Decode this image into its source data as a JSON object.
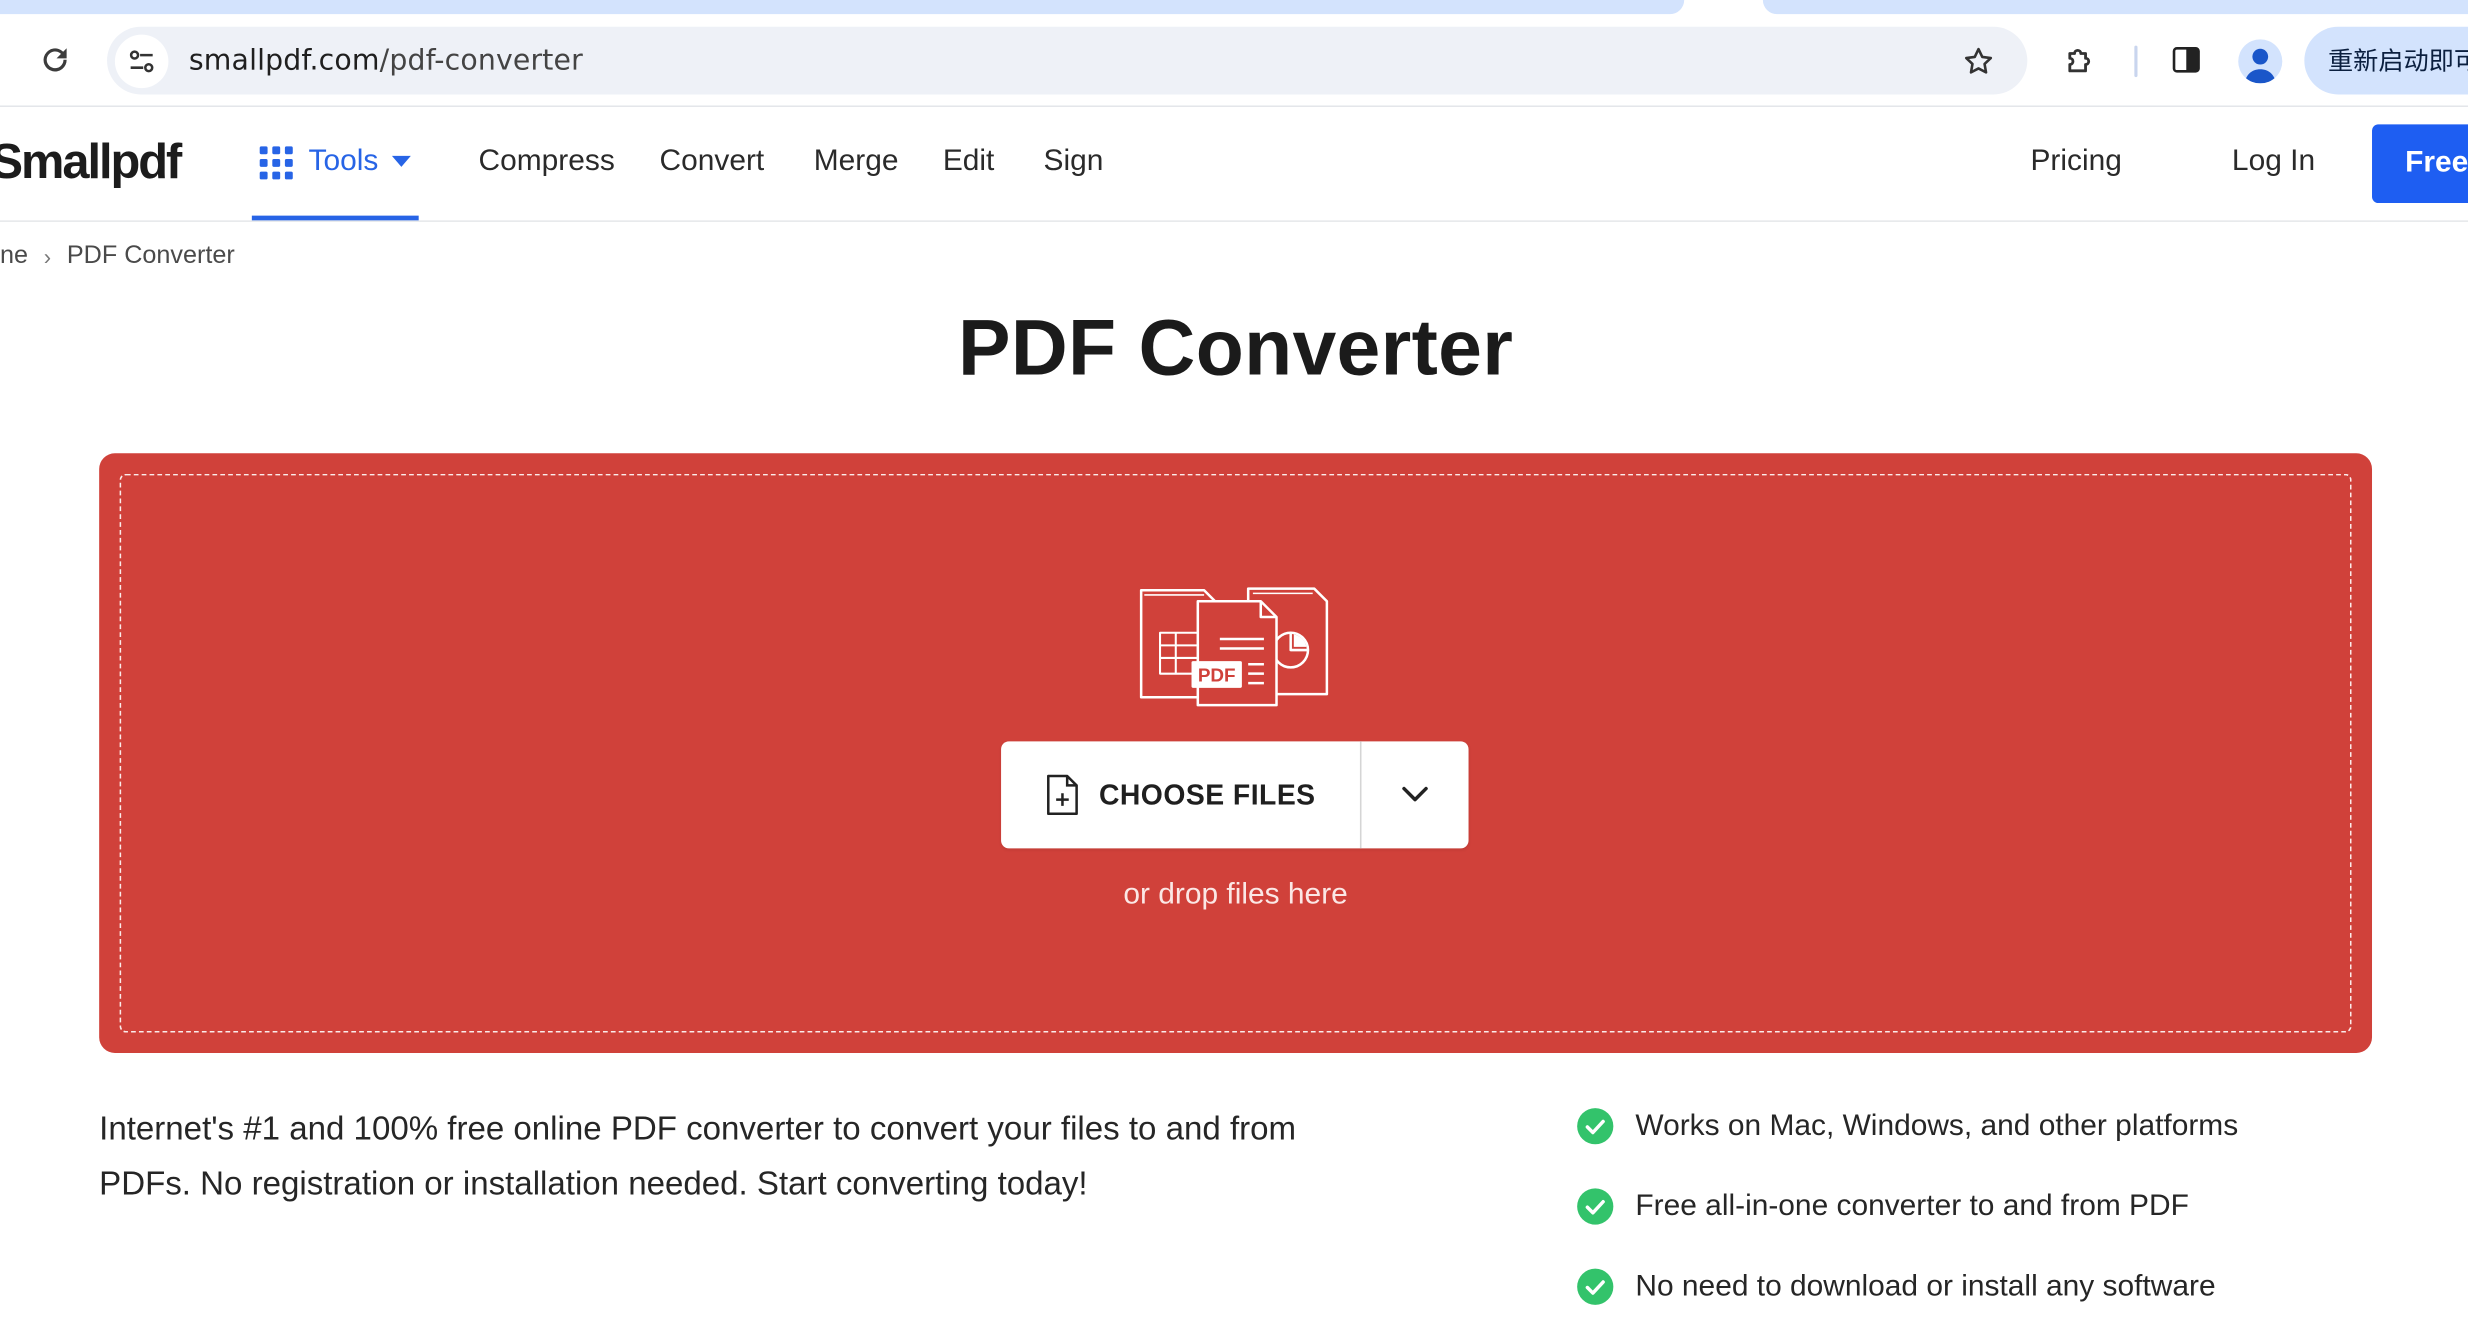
{
  "browser": {
    "url_host": "smallpdf.com",
    "url_path": "/pdf-converter",
    "relaunch_label": "重新启动即可"
  },
  "nav": {
    "logo": "Smallpdf",
    "tools_label": "Tools",
    "links": [
      "Compress",
      "Convert",
      "Merge",
      "Edit",
      "Sign"
    ],
    "pricing": "Pricing",
    "login": "Log In",
    "cta": "Free"
  },
  "breadcrumb": {
    "home": "ne",
    "current": "PDF Converter"
  },
  "title": "PDF Converter",
  "dropzone": {
    "pdf_badge": "PDF",
    "choose_label": "CHOOSE FILES",
    "hint": "or drop files here",
    "bg_color": "#d0413a"
  },
  "description": "Internet's #1 and 100% free online PDF converter to convert your files to and from PDFs. No registration or installation needed. Start converting today!",
  "features": [
    "Works on Mac, Windows, and other platforms",
    "Free all-in-one converter to and from PDF",
    "No need to download or install any software"
  ],
  "colors": {
    "accent": "#2764e6",
    "cta": "#1e5ef2",
    "check": "#33c36b"
  }
}
